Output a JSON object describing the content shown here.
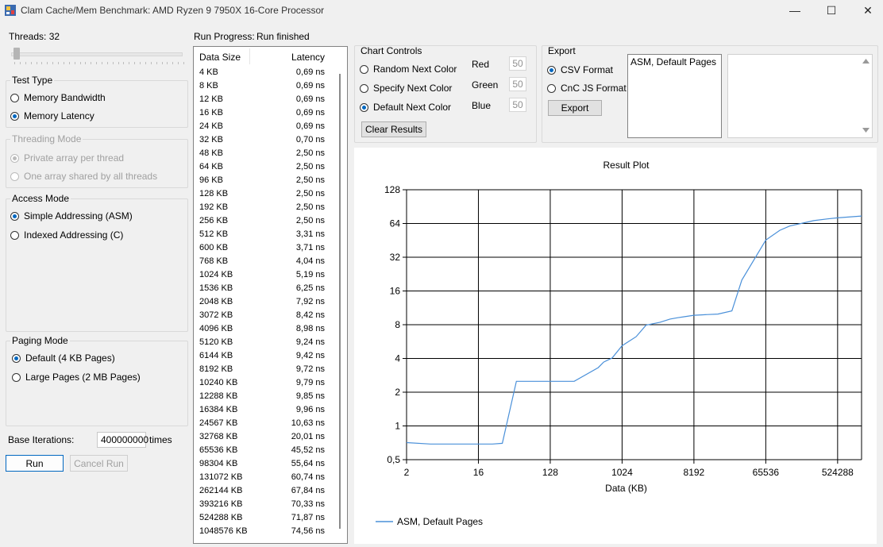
{
  "window": {
    "title": "Clam Cache/Mem Benchmark: AMD Ryzen 9 7950X 16-Core Processor",
    "minimize_glyph": "—",
    "maximize_glyph": "☐",
    "close_glyph": "✕"
  },
  "threads": {
    "label": "Threads: 32",
    "value": 32
  },
  "test_type": {
    "title": "Test Type",
    "options": [
      {
        "label": "Memory Bandwidth",
        "selected": false
      },
      {
        "label": "Memory Latency",
        "selected": true
      }
    ]
  },
  "threading_mode": {
    "title": "Threading Mode",
    "options": [
      {
        "label": "Private array per thread",
        "selected": true
      },
      {
        "label": "One array shared by all threads",
        "selected": false
      }
    ]
  },
  "access_mode": {
    "title": "Access Mode",
    "options": [
      {
        "label": "Simple Addressing (ASM)",
        "selected": true
      },
      {
        "label": "Indexed Addressing (C)",
        "selected": false
      }
    ]
  },
  "paging_mode": {
    "title": "Paging Mode",
    "options": [
      {
        "label": "Default (4 KB Pages)",
        "selected": true
      },
      {
        "label": "Large Pages (2 MB Pages)",
        "selected": false
      }
    ]
  },
  "base_iterations": {
    "label": "Base Iterations:",
    "value": "400000000",
    "suffix": "times"
  },
  "buttons": {
    "run": "Run",
    "cancel": "Cancel Run"
  },
  "run_progress": {
    "label": "Run Progress:",
    "status": "Run finished"
  },
  "results": {
    "columns": [
      "Data Size",
      "Latency"
    ],
    "rows": [
      [
        "4 KB",
        "0,69 ns"
      ],
      [
        "8 KB",
        "0,69 ns"
      ],
      [
        "12 KB",
        "0,69 ns"
      ],
      [
        "16 KB",
        "0,69 ns"
      ],
      [
        "24 KB",
        "0,69 ns"
      ],
      [
        "32 KB",
        "0,70 ns"
      ],
      [
        "48 KB",
        "2,50 ns"
      ],
      [
        "64 KB",
        "2,50 ns"
      ],
      [
        "96 KB",
        "2,50 ns"
      ],
      [
        "128 KB",
        "2,50 ns"
      ],
      [
        "192 KB",
        "2,50 ns"
      ],
      [
        "256 KB",
        "2,50 ns"
      ],
      [
        "512 KB",
        "3,31 ns"
      ],
      [
        "600 KB",
        "3,71 ns"
      ],
      [
        "768 KB",
        "4,04 ns"
      ],
      [
        "1024 KB",
        "5,19 ns"
      ],
      [
        "1536 KB",
        "6,25 ns"
      ],
      [
        "2048 KB",
        "7,92 ns"
      ],
      [
        "3072 KB",
        "8,42 ns"
      ],
      [
        "4096 KB",
        "8,98 ns"
      ],
      [
        "5120 KB",
        "9,24 ns"
      ],
      [
        "6144 KB",
        "9,42 ns"
      ],
      [
        "8192 KB",
        "9,72 ns"
      ],
      [
        "10240 KB",
        "9,79 ns"
      ],
      [
        "12288 KB",
        "9,85 ns"
      ],
      [
        "16384 KB",
        "9,96 ns"
      ],
      [
        "24567 KB",
        "10,63 ns"
      ],
      [
        "32768 KB",
        "20,01 ns"
      ],
      [
        "65536 KB",
        "45,52 ns"
      ],
      [
        "98304 KB",
        "55,64 ns"
      ],
      [
        "131072 KB",
        "60,74 ns"
      ],
      [
        "262144 KB",
        "67,84 ns"
      ],
      [
        "393216 KB",
        "70,33 ns"
      ],
      [
        "524288 KB",
        "71,87 ns"
      ],
      [
        "1048576 KB",
        "74,56 ns"
      ]
    ]
  },
  "chart_controls": {
    "title": "Chart Controls",
    "options": [
      {
        "label": "Random Next Color",
        "selected": false
      },
      {
        "label": "Specify Next Color",
        "selected": false
      },
      {
        "label": "Default Next Color",
        "selected": true
      }
    ],
    "red_label": "Red",
    "red_value": "50",
    "green_label": "Green",
    "green_value": "50",
    "blue_label": "Blue",
    "blue_value": "50",
    "clear_button": "Clear Results"
  },
  "export": {
    "title": "Export",
    "options": [
      {
        "label": "CSV Format",
        "selected": true
      },
      {
        "label": "CnC JS Format",
        "selected": false
      }
    ],
    "button": "Export",
    "series_list": [
      "ASM, Default Pages"
    ],
    "output_text": ""
  },
  "chart_data": {
    "type": "line",
    "title": "Result Plot",
    "xlabel": "Data (KB)",
    "ylabel": "",
    "x_scale": "log2",
    "y_scale": "log2",
    "xlim": [
      2,
      1048576
    ],
    "ylim": [
      0.5,
      128
    ],
    "x_ticks": [
      2,
      16,
      128,
      1024,
      8192,
      65536,
      524288
    ],
    "y_ticks": [
      0.5,
      1,
      2,
      4,
      8,
      16,
      32,
      64,
      128
    ],
    "x_tick_labels": [
      "2",
      "16",
      "128",
      "1024",
      "8192",
      "65536",
      "524288"
    ],
    "y_tick_labels": [
      "0,5",
      "1",
      "2",
      "4",
      "8",
      "16",
      "32",
      "64",
      "128"
    ],
    "grid": true,
    "legend": "bottom-left",
    "series": [
      {
        "name": "ASM, Default Pages",
        "color": "#4a90d9",
        "x": [
          2,
          4,
          8,
          12,
          16,
          24,
          32,
          48,
          64,
          96,
          128,
          192,
          256,
          512,
          600,
          768,
          1024,
          1536,
          2048,
          3072,
          4096,
          5120,
          6144,
          8192,
          10240,
          12288,
          16384,
          24567,
          32768,
          65536,
          98304,
          131072,
          262144,
          393216,
          524288,
          1048576
        ],
        "y": [
          0.71,
          0.69,
          0.69,
          0.69,
          0.69,
          0.69,
          0.7,
          2.5,
          2.5,
          2.5,
          2.5,
          2.5,
          2.5,
          3.31,
          3.71,
          4.04,
          5.19,
          6.25,
          7.92,
          8.42,
          8.98,
          9.24,
          9.42,
          9.72,
          9.79,
          9.85,
          9.96,
          10.63,
          20.01,
          45.52,
          55.64,
          60.74,
          67.84,
          70.33,
          71.87,
          74.56
        ]
      }
    ]
  }
}
